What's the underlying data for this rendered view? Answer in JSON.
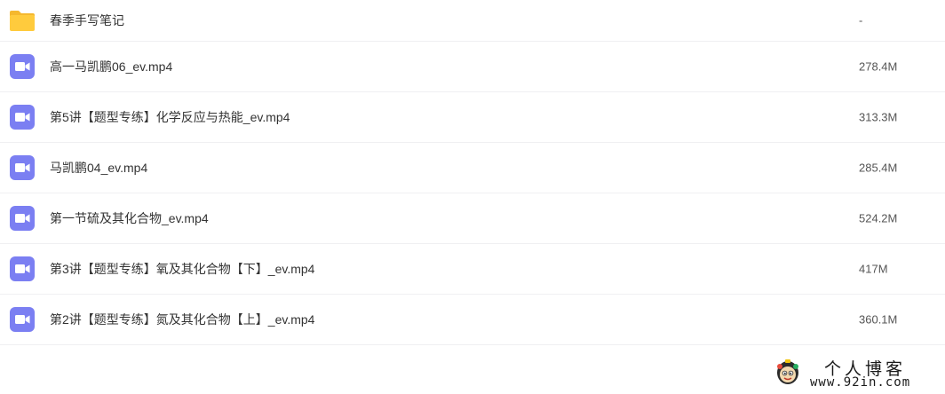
{
  "files": [
    {
      "name": "春季手写笔记",
      "size": "-",
      "icon": "folder-icon",
      "type": "folder"
    },
    {
      "name": "高一马凯鹏06_ev.mp4",
      "size": "278.4M",
      "icon": "video-file-icon",
      "type": "video"
    },
    {
      "name": "第5讲【题型专练】化学反应与热能_ev.mp4",
      "size": "313.3M",
      "icon": "video-file-icon",
      "type": "video"
    },
    {
      "name": "马凯鹏04_ev.mp4",
      "size": "285.4M",
      "icon": "video-file-icon",
      "type": "video"
    },
    {
      "name": "第一节硫及其化合物_ev.mp4",
      "size": "524.2M",
      "icon": "video-file-icon",
      "type": "video"
    },
    {
      "name": "第3讲【题型专练】氧及其化合物【下】_ev.mp4",
      "size": "417M",
      "icon": "video-file-icon",
      "type": "video"
    },
    {
      "name": "第2讲【题型专练】氮及其化合物【上】_ev.mp4",
      "size": "360.1M",
      "icon": "video-file-icon",
      "type": "video"
    }
  ],
  "watermark": {
    "title": "个人博客",
    "url": "www.92in.com",
    "icon": "mascot-logo"
  },
  "colors": {
    "folder": "#FFCB3D",
    "folder_tab": "#F5B82E",
    "video_icon": "#7B7FF2",
    "row_divider": "#f0f0f2",
    "text": "#333333"
  }
}
